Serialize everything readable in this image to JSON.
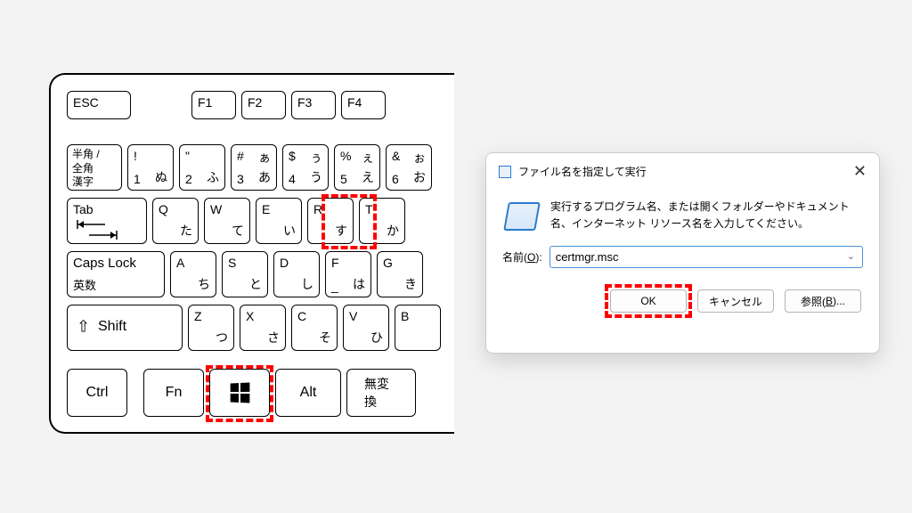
{
  "keyboard": {
    "esc": "ESC",
    "f": [
      "F1",
      "F2",
      "F3",
      "F4"
    ],
    "row1_left": {
      "l1": "半角 /",
      "l2": "全角",
      "l3": "漢字"
    },
    "row1": [
      {
        "tl": "!",
        "bl": "1",
        "br": "ぬ"
      },
      {
        "tl": "\"",
        "bl": "2",
        "br": "ふ"
      },
      {
        "tl": "#",
        "tr": "ぁ",
        "bl": "3",
        "br": "あ"
      },
      {
        "tl": "$",
        "tr": "ぅ",
        "bl": "4",
        "br": "う"
      },
      {
        "tl": "%",
        "tr": "ぇ",
        "bl": "5",
        "br": "え"
      },
      {
        "tl": "&",
        "tr": "ぉ",
        "bl": "6",
        "br": "お"
      }
    ],
    "tab": "Tab",
    "row2": [
      {
        "tl": "Q",
        "br": "た"
      },
      {
        "tl": "W",
        "br": "て"
      },
      {
        "tl": "E",
        "br": "い"
      },
      {
        "tl": "R",
        "br": "す"
      },
      {
        "tl": "T",
        "br": "か"
      }
    ],
    "caps_top": "Caps Lock",
    "caps_bot": "英数",
    "row3": [
      {
        "tl": "A",
        "br": "ち"
      },
      {
        "tl": "S",
        "br": "と"
      },
      {
        "tl": "D",
        "br": "し"
      },
      {
        "tl": "F",
        "br": "は",
        "bl": "_"
      },
      {
        "tl": "G",
        "br": "き"
      }
    ],
    "shift": "Shift",
    "row4": [
      {
        "tl": "Z",
        "br": "つ"
      },
      {
        "tl": "X",
        "br": "さ"
      },
      {
        "tl": "C",
        "br": "そ"
      },
      {
        "tl": "V",
        "br": "ひ"
      },
      {
        "tl": "B"
      }
    ],
    "bottom": {
      "ctrl": "Ctrl",
      "fn": "Fn",
      "alt": "Alt",
      "muhen": "無変換"
    }
  },
  "dialog": {
    "title": "ファイル名を指定して実行",
    "desc": "実行するプログラム名、または開くフォルダーやドキュメント名、インターネット リソース名を入力してください。",
    "name_label_pre": "名前(",
    "name_label_u": "O",
    "name_label_post": "):",
    "input_value": "certmgr.msc",
    "ok": "OK",
    "cancel": "キャンセル",
    "browse_pre": "参照(",
    "browse_u": "B",
    "browse_post": ")..."
  },
  "highlights": {
    "r_key": true,
    "win_key": true,
    "ok_button": true
  }
}
